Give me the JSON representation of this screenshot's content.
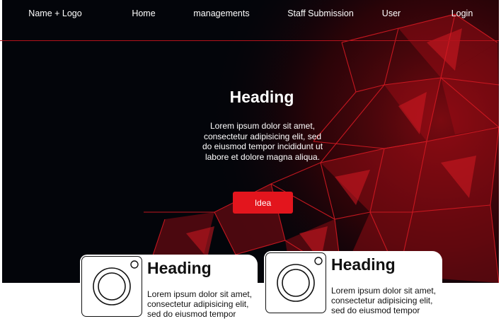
{
  "nav": {
    "logo": "Name + Logo",
    "items": [
      "Home",
      "managements",
      "Staff Submission",
      "User",
      "Login"
    ]
  },
  "hero": {
    "heading": "Heading",
    "body": "Lorem ipsum dolor sit amet, consectetur adipisicing elit, sed do eiusmod tempor incididunt ut labore et dolore magna aliqua.",
    "button_label": "Idea"
  },
  "cards": [
    {
      "heading": "Heading",
      "text": "Lorem ipsum dolor sit amet, consectetur adipisicing elit, sed do eiusmod tempor"
    },
    {
      "heading": "Heading",
      "text": "Lorem ipsum dolor sit amet, consectetur adipisicing elit, sed do eiusmod tempor"
    }
  ],
  "colors": {
    "background": "#03050a",
    "accent": "#e3151d",
    "text_light": "#ffffff"
  },
  "icons": {
    "card_image": "camera-icon"
  }
}
